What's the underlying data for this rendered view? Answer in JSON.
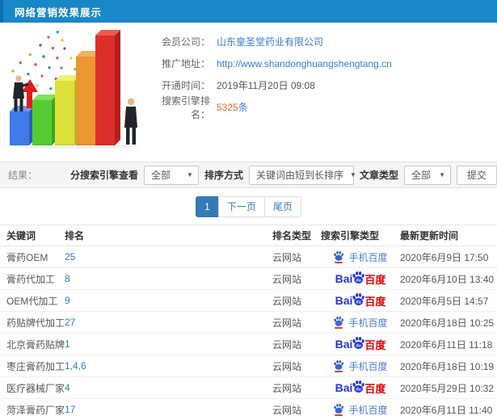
{
  "header": {
    "title": "网络营销效果展示"
  },
  "info": {
    "rows": [
      {
        "label": "会员公司：",
        "value": "山东皇圣堂药业有限公司"
      },
      {
        "label": "推广地址：",
        "value": "http://www.shandonghuangshengtang.cn"
      },
      {
        "label": "开通时间：",
        "value": "2019年11月20日 09:08"
      },
      {
        "label": "搜索引擎排名：",
        "value_number": "5325",
        "value_unit": "条"
      }
    ]
  },
  "filters": {
    "result_label": "结果：",
    "engine_label": "分搜索引擎查看",
    "engine_value": "全部",
    "sort_label": "排序方式",
    "sort_value": "关键词由短到长排序",
    "article_label": "文章类型",
    "article_value": "全部",
    "submit_label": "提交",
    "caret": "▼"
  },
  "pagination": {
    "current": "1",
    "next": "下一页",
    "last": "尾页"
  },
  "logos": {
    "bai": "Bai",
    "du": "du",
    "cn": "百度",
    "mobile_label": "手机百度"
  },
  "table": {
    "headers": [
      "关键词",
      "排名",
      "排名类型",
      "搜索引擎类型",
      "最新更新时间"
    ],
    "rows": [
      {
        "keyword": "膏药OEM",
        "rank": "25",
        "rank_type": "云网站",
        "engine": "mobile",
        "updated": "2020年6月9日 17:50"
      },
      {
        "keyword": "膏药代加工",
        "rank": "8",
        "rank_type": "云网站",
        "engine": "pc",
        "updated": "2020年6月10日 13:40"
      },
      {
        "keyword": "OEM代加工",
        "rank": "9",
        "rank_type": "云网站",
        "engine": "pc",
        "updated": "2020年6月5日 14:57"
      },
      {
        "keyword": "药贴牌代加工",
        "rank": "27",
        "rank_type": "云网站",
        "engine": "mobile",
        "updated": "2020年6月18日 10:25"
      },
      {
        "keyword": "北京膏药贴牌",
        "rank": "1",
        "rank_type": "云网站",
        "engine": "pc",
        "updated": "2020年6月11日 11:18"
      },
      {
        "keyword": "枣庄膏药加工",
        "rank": "1,4,6",
        "rank_type": "云网站",
        "engine": "mobile",
        "updated": "2020年6月18日 10:19"
      },
      {
        "keyword": "医疗器械厂家",
        "rank": "4",
        "rank_type": "云网站",
        "engine": "pc",
        "updated": "2020年5月29日 10:32"
      },
      {
        "keyword": "菏泽膏药厂家",
        "rank": "17",
        "rank_type": "云网站",
        "engine": "mobile",
        "updated": "2020年6月11日 11:40"
      }
    ]
  },
  "colors": {
    "topbar": "#1987c8",
    "accent_link": "#3a7bd5",
    "highlight_orange": "#f4622a",
    "baidu_blue": "#2932e1",
    "baidu_red": "#e10602",
    "pager_active": "#337ab7"
  }
}
